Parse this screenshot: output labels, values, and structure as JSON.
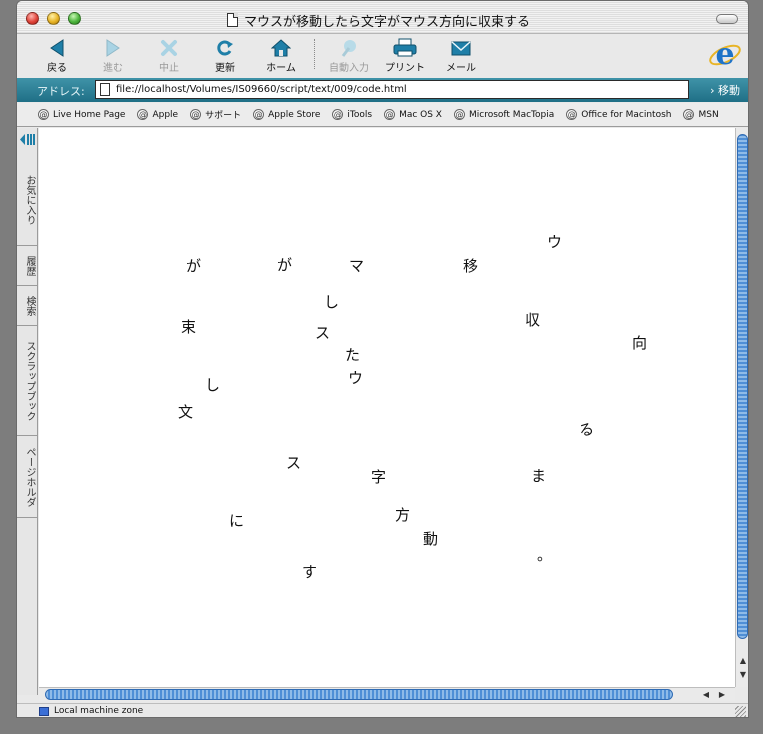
{
  "window": {
    "title": "マウスが移動したら文字がマウス方向に収束する"
  },
  "toolbar": {
    "back": "戻る",
    "forward": "進む",
    "stop": "中止",
    "refresh": "更新",
    "home": "ホーム",
    "autofill": "自動入力",
    "print": "プリント",
    "mail": "メール"
  },
  "address_bar": {
    "label": "アドレス:",
    "url": "file://localhost/Volumes/IS09660/script/text/009/code.html",
    "go": "移動"
  },
  "favorites": [
    "Live Home Page",
    "Apple",
    "サポート",
    "Apple Store",
    "iTools",
    "Mac OS X",
    "Microsoft MacTopia",
    "Office for Macintosh",
    "MSN"
  ],
  "explorer_tabs": [
    "お気に入り",
    "履歴",
    "検索",
    "スクラップブック",
    "ページホルダ"
  ],
  "page_chars": [
    "ウ",
    "が",
    "が",
    "マ",
    "移",
    "し",
    "束",
    "ス",
    "収",
    "向",
    "た",
    "ウ",
    "し",
    "文",
    "る",
    "ス",
    "字",
    "ま",
    "に",
    "方",
    "動",
    "。",
    "す"
  ],
  "status": {
    "zone": "Local machine zone"
  }
}
